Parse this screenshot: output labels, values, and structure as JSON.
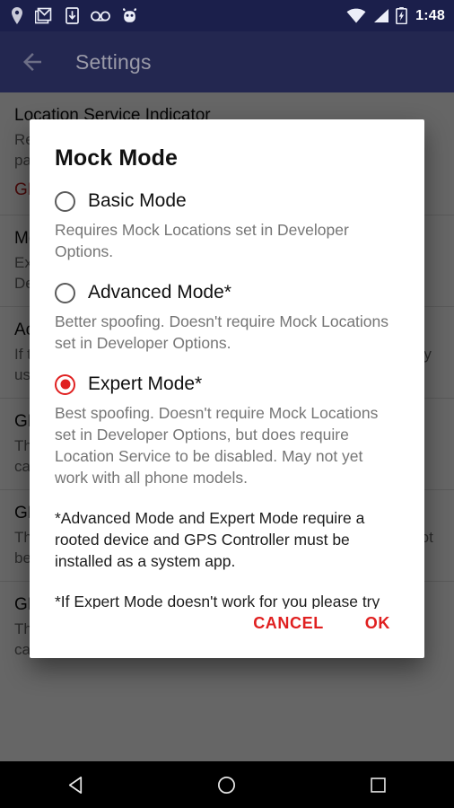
{
  "status_bar": {
    "icons": [
      "location-pin-icon",
      "gmail-icon",
      "download-icon",
      "voicemail-icon",
      "android-head-icon"
    ],
    "wifi_icon": "wifi-icon",
    "signal_icon": "cell-signal-icon",
    "battery_icon": "battery-charging-icon",
    "time": "1:48"
  },
  "app_bar": {
    "back_icon": "back-arrow-icon",
    "title": "Settings"
  },
  "background_list": [
    {
      "title": "Location Service Indicator",
      "desc": "Requires root.  Hides the location indicator in the notification panel.",
      "sub_title": "GPS Controller is not installed as a system app.",
      "sub_is_red": true
    },
    {
      "title": "Mock Mode",
      "desc": "Expert Mode*  Better spoofing without Mock Locations set in Developer Options.  Tap to change."
    },
    {
      "title": "Accuracy",
      "desc": "If this value is too small some apps may detect spoofing.  Only used if accuracy cannot be set. (meters)"
    },
    {
      "title": "GPS Bearing Contingency",
      "desc": "The bearing of the GPS coordinates.  Only used if bearing cannot be automatically calculated. (degrees)"
    },
    {
      "title": "GPS Speed Contingency",
      "desc": "The speed of the GPS coordinates.  Only used if speed cannot be automatically calculated. (m/s)"
    },
    {
      "title": "GPS Altitude Contingency",
      "desc": "The altitude of the GPS coordinates.  Only used if altitude cannot be automatically calculated. (meters)"
    }
  ],
  "dialog": {
    "title": "Mock Mode",
    "options": [
      {
        "label": "Basic Mode",
        "desc": "Requires Mock Locations set in Developer Options.",
        "selected": false
      },
      {
        "label": "Advanced Mode*",
        "desc": "Better spoofing.  Doesn't require Mock Locations set in Developer Options.",
        "selected": false
      },
      {
        "label": "Expert Mode*",
        "desc": "Best spoofing.  Doesn't require Mock Locations set in Developer Options, but does require Location Service to be disabled.  May not yet work with all phone models.",
        "selected": true
      }
    ],
    "footnotes": [
      "*Advanced Mode and Expert Mode require a rooted device and GPS Controller must be installed as a system app.",
      "*If Expert Mode doesn't work for you please try Advanced Mode instead."
    ],
    "cancel_label": "CANCEL",
    "ok_label": "OK",
    "accent_color": "#e02020"
  },
  "nav_bar": {
    "back": "nav-back-icon",
    "home": "nav-home-icon",
    "recents": "nav-recents-icon"
  }
}
